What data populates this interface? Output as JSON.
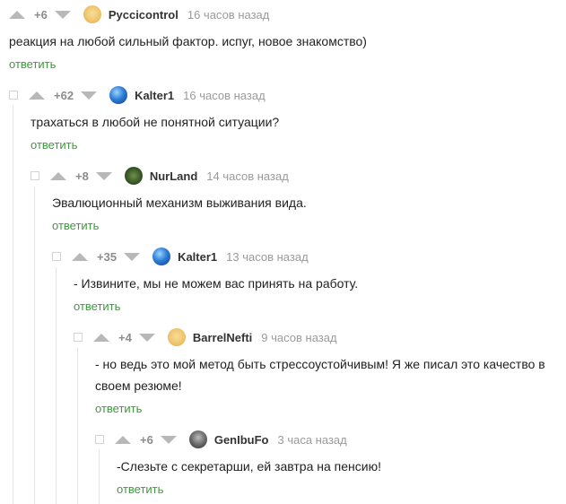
{
  "comments": [
    {
      "rating": "+6",
      "author": "Pyccicontrol",
      "time": "16 часов назад",
      "text": "реакция на любой сильный фактор. испуг, новое знакомство)",
      "reply": "ответить",
      "avatar": "cheetos-avatar"
    },
    {
      "rating": "+62",
      "author": "Kalter1",
      "time": "16 часов назад",
      "text": "трахаться в любой не понятной ситуации?",
      "reply": "ответить",
      "avatar": "globe-avatar"
    },
    {
      "rating": "+8",
      "author": "NurLand",
      "time": "14 часов назад",
      "text": "Эвалюционный механизм выживания вида.",
      "reply": "ответить",
      "avatar": "forest-avatar"
    },
    {
      "rating": "+35",
      "author": "Kalter1",
      "time": "13 часов назад",
      "text": "- Извините, мы не можем вас принять на работу.",
      "reply": "ответить",
      "avatar": "globe-avatar"
    },
    {
      "rating": "+4",
      "author": "BarrelNefti",
      "time": "9 часов назад",
      "text_line1": "- но ведь это мой метод быть стрессоустойчивым! Я же писал это качество в",
      "text_line2": "своем резюме!",
      "reply": "ответить",
      "avatar": "cheetos-avatar"
    },
    {
      "rating": "+6",
      "author": "GenIbuFo",
      "time": "3 часа назад",
      "text": "-Слезьте с секретарши, ей завтра на пенсию!",
      "reply": "ответить",
      "avatar": "wolf-avatar"
    }
  ],
  "colors": {
    "reply_link": "#3c9a3c",
    "vote_arrow": "#b8b8b8",
    "time_text": "#9a9a9a",
    "branch_line": "#e4e4e4"
  }
}
